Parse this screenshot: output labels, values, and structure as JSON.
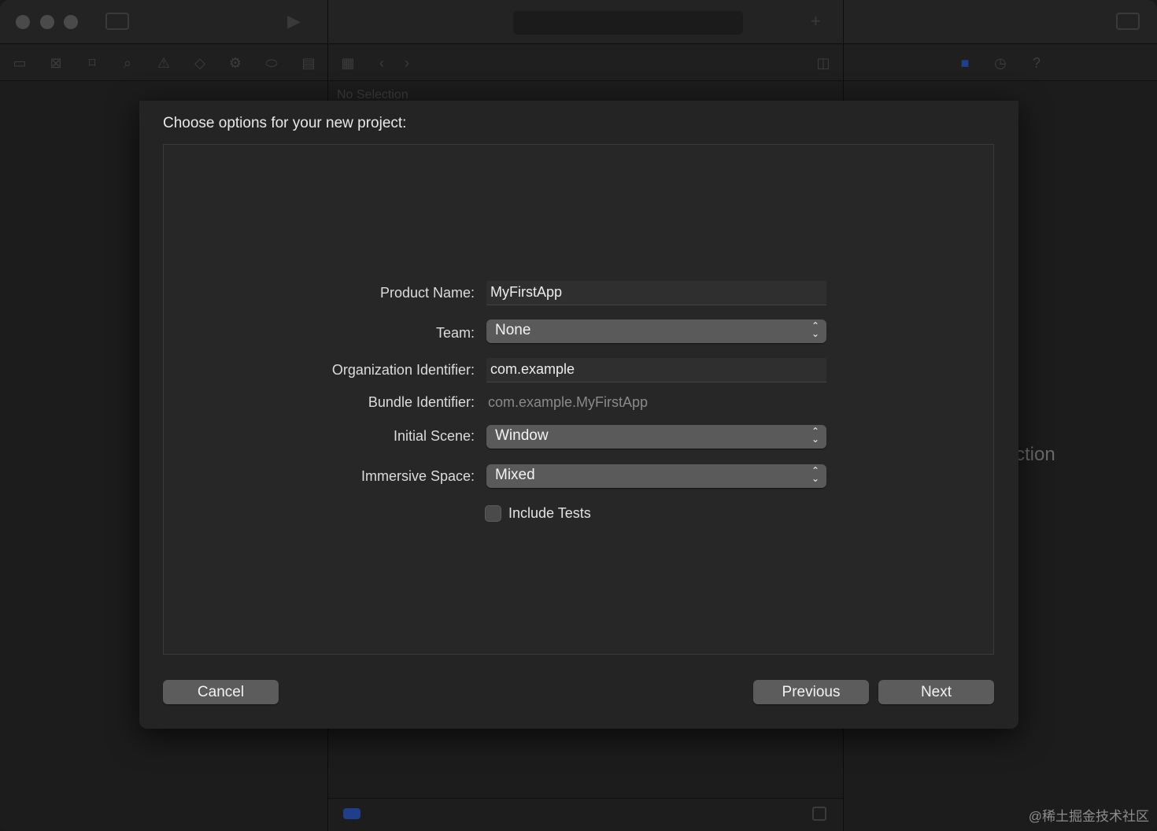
{
  "sheet": {
    "title": "Choose options for your new project:"
  },
  "form": {
    "product_name": {
      "label": "Product Name:",
      "value": "MyFirstApp"
    },
    "team": {
      "label": "Team:",
      "value": "None"
    },
    "organization_identifier": {
      "label": "Organization Identifier:",
      "value": "com.example"
    },
    "bundle_identifier": {
      "label": "Bundle Identifier:",
      "value": "com.example.MyFirstApp"
    },
    "initial_scene": {
      "label": "Initial Scene:",
      "value": "Window"
    },
    "immersive_space": {
      "label": "Immersive Space:",
      "value": "Mixed"
    },
    "include_tests": {
      "label": "Include Tests",
      "checked": false
    }
  },
  "buttons": {
    "cancel": "Cancel",
    "previous": "Previous",
    "next": "Next"
  },
  "background": {
    "no_selection": "No Selection",
    "inspector_fragment": "ction"
  },
  "watermark": "@稀土掘金技术社区",
  "colors": {
    "sheet_bg": "#242424",
    "panel_bg": "#272727",
    "button_bg": "#5c5c5c",
    "accent_blue": "#1f3f8a"
  }
}
